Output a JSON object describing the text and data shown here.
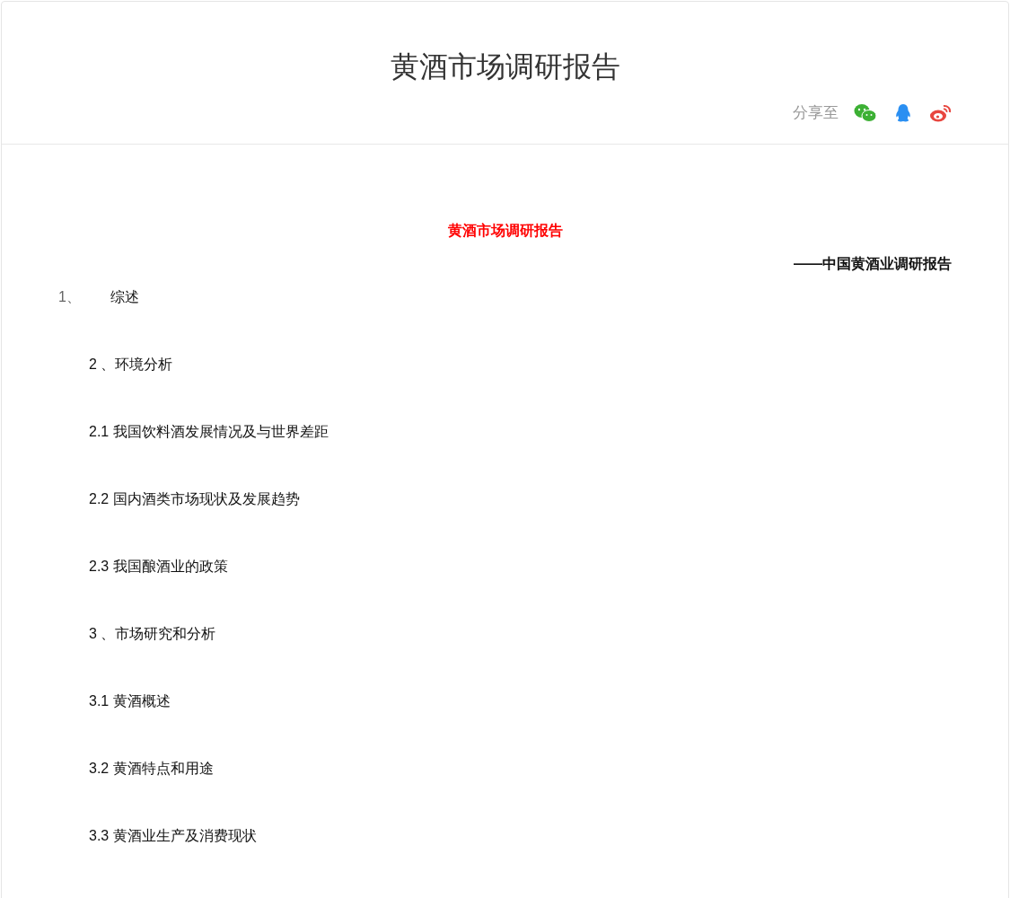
{
  "page_title": "黄酒市场调研报告",
  "share": {
    "label": "分享至"
  },
  "document": {
    "title": "黄酒市场调研报告",
    "subtitle": "——中国黄酒业调研报告",
    "first_item": {
      "number": "1、",
      "text": "综述"
    },
    "items": [
      "2 、环境分析",
      "2.1 我国饮料酒发展情况及与世界差距",
      "2.2 国内酒类市场现状及发展趋势",
      "2.3 我国酿酒业的政策",
      "3 、市场研究和分析",
      "3.1 黄酒概述",
      "3.2 黄酒特点和用途",
      "3.3 黄酒业生产及消费现状"
    ]
  }
}
